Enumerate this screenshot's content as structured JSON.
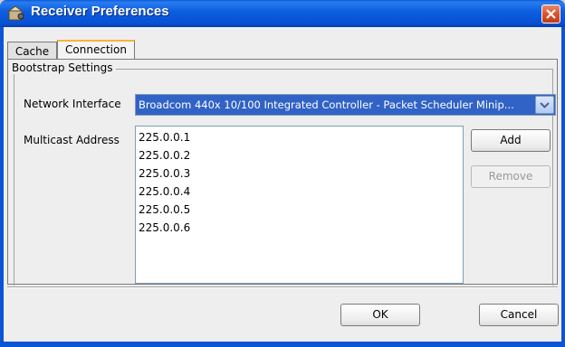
{
  "window": {
    "title": "Receiver Preferences",
    "accent": "#0b55d6"
  },
  "tabs": [
    {
      "label": "Cache"
    },
    {
      "label": "Connection",
      "selected": true
    }
  ],
  "bootstrap": {
    "group_title": "Bootstrap Settings",
    "network_interface_label": "Network Interface",
    "network_interface_value": "Broadcom 440x 10/100 Integrated Controller - Packet Scheduler Minip...",
    "multicast_label": "Multicast Address",
    "addresses": [
      "225.0.0.1",
      "225.0.0.2",
      "225.0.0.3",
      "225.0.0.4",
      "225.0.0.5",
      "225.0.0.6"
    ],
    "add_label": "Add",
    "remove_label": "Remove"
  },
  "footer": {
    "ok_label": "OK",
    "cancel_label": "Cancel"
  },
  "icons": {
    "app": "receiver-app-icon",
    "close": "close-icon",
    "dropdown": "chevron-down-icon"
  }
}
